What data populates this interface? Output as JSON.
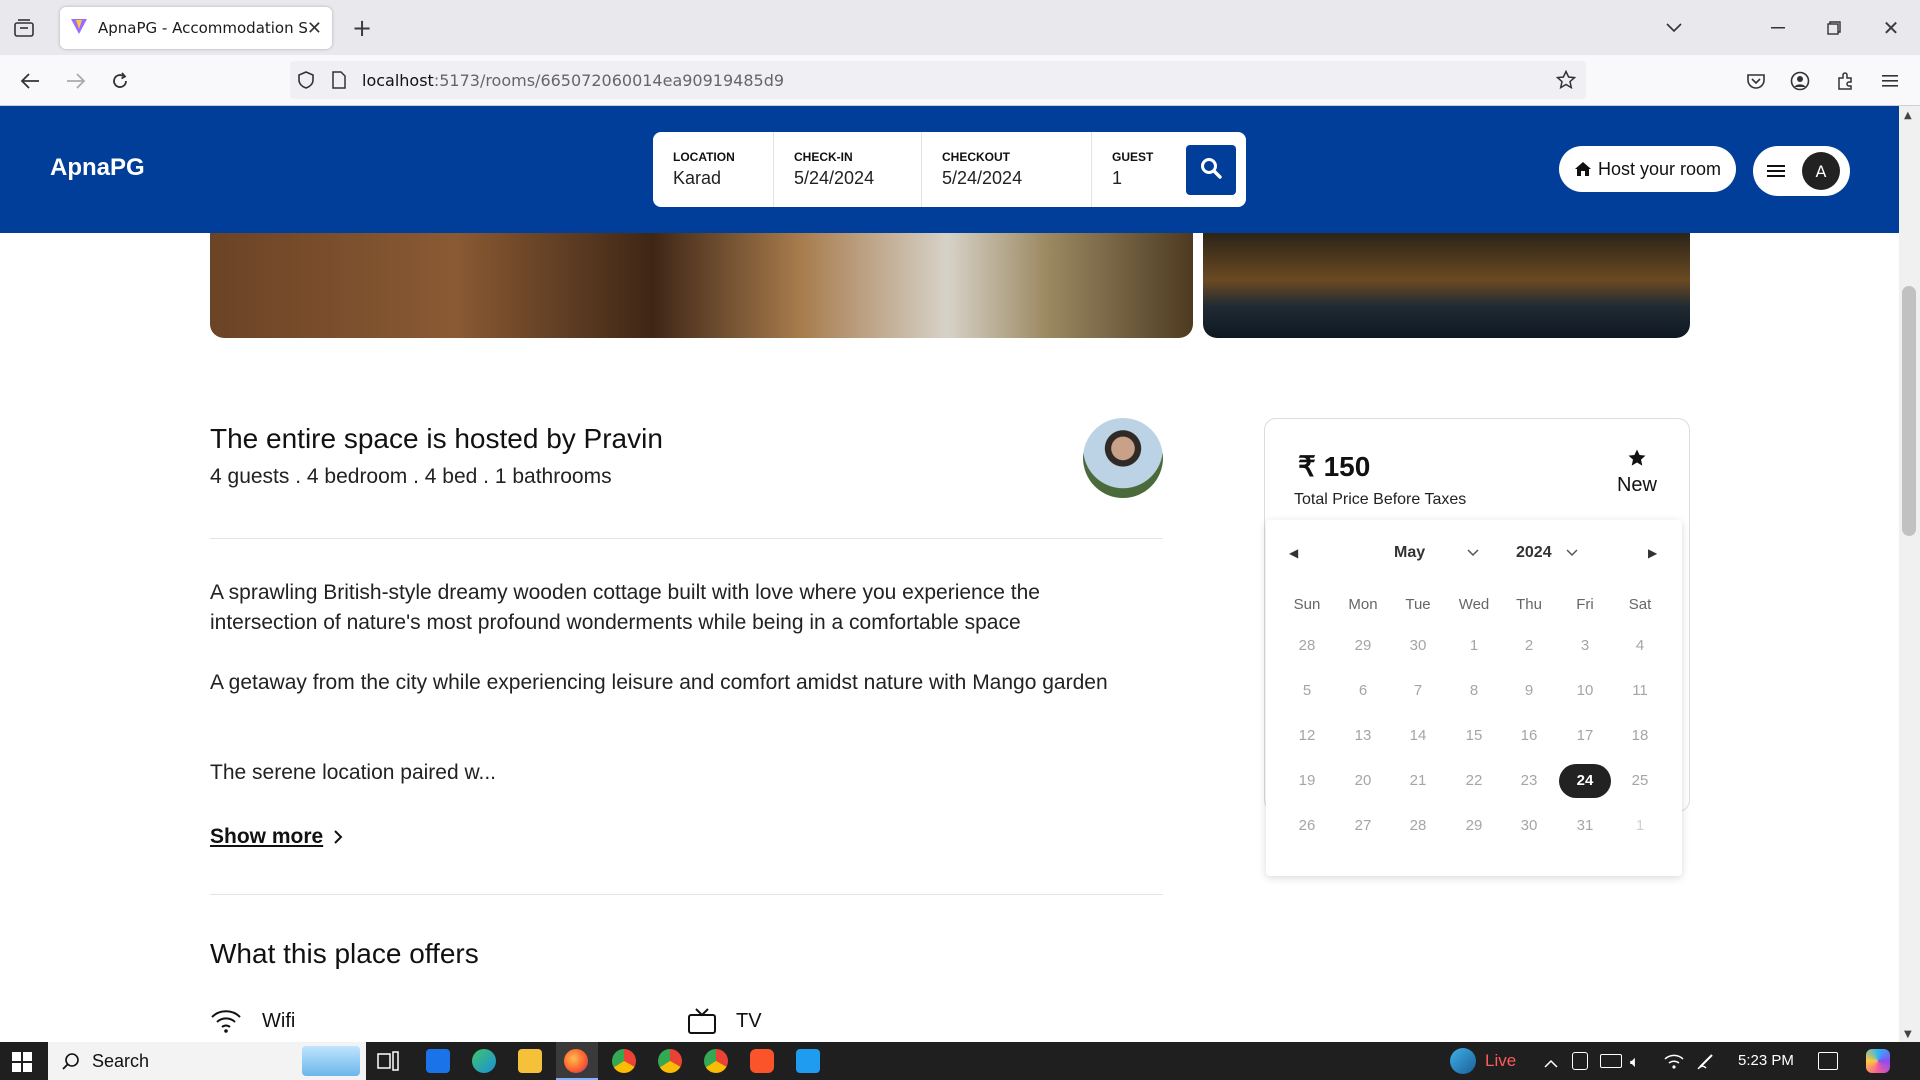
{
  "browser": {
    "tab_title": "ApnaPG - Accommodation Solu",
    "url_host": "localhost",
    "url_rest": ":5173/rooms/665072060014ea90919485d9"
  },
  "header": {
    "logo": "ApnaPG",
    "search": {
      "location_label": "LOCATION",
      "location_value": "Karad",
      "checkin_label": "CHECK-IN",
      "checkin_value": "5/24/2024",
      "checkout_label": "CHECKOUT",
      "checkout_value": "5/24/2024",
      "guest_label": "GUEST",
      "guest_value": "1"
    },
    "host_button": "Host your room",
    "avatar_initial": "A"
  },
  "room": {
    "host_title": "The entire space is hosted by Pravin",
    "meta": "4 guests . 4 bedroom . 4 bed . 1 bathrooms",
    "description": [
      "A sprawling British-style dreamy wooden cottage built with love where you experience the intersection of nature's most profound wonderments while being in a comfortable space",
      "A getaway from the city while experiencing leisure and comfort amidst nature with Mango garden",
      "The serene location paired w..."
    ],
    "show_more": "Show more",
    "offers_title": "What this place offers",
    "amenities": [
      "Wifi",
      "TV"
    ]
  },
  "price_card": {
    "price": "₹ 150",
    "subtitle": "Total Price Before Taxes",
    "rating_label": "New"
  },
  "calendar": {
    "month": "May",
    "year": "2024",
    "weekdays": [
      "Sun",
      "Mon",
      "Tue",
      "Wed",
      "Thu",
      "Fri",
      "Sat"
    ],
    "weeks": [
      [
        "28",
        "29",
        "30",
        "1",
        "2",
        "3",
        "4"
      ],
      [
        "5",
        "6",
        "7",
        "8",
        "9",
        "10",
        "11"
      ],
      [
        "12",
        "13",
        "14",
        "15",
        "16",
        "17",
        "18"
      ],
      [
        "19",
        "20",
        "21",
        "22",
        "23",
        "24",
        "25"
      ],
      [
        "26",
        "27",
        "28",
        "29",
        "30",
        "31",
        "1"
      ]
    ],
    "selected": "24"
  },
  "taskbar": {
    "search_label": "Search",
    "live_label": "Live",
    "time": "5:23 PM"
  }
}
